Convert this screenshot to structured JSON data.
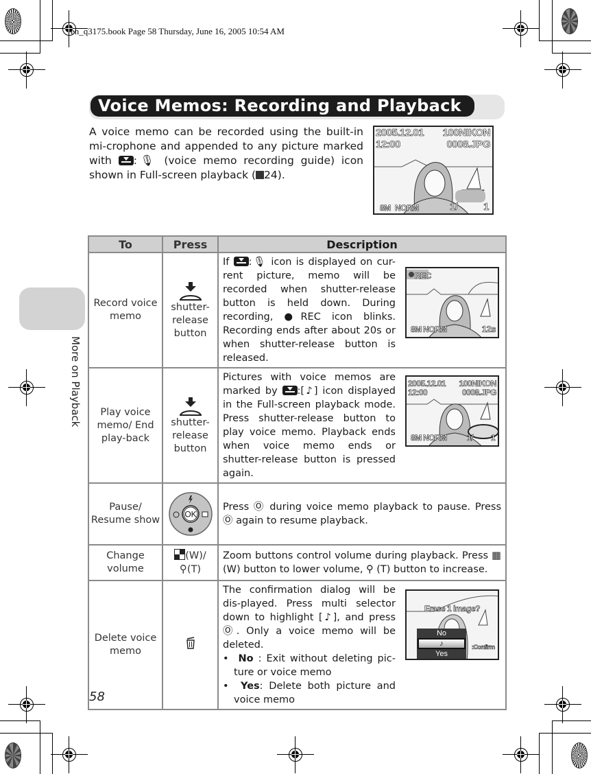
{
  "slug": "en_q3175.book  Page 58  Thursday, June 16, 2005  10:54 AM",
  "title": "Voice Memos: Recording and Playback",
  "intro": {
    "part1": "A voice memo can be recorded using the built-in mi-crophone and appended to any picture marked with",
    "part2": ":🎙 (voice memo recording guide) icon shown in Full-screen playback (",
    "ref": "24",
    "part3": ")."
  },
  "side_tab": "More on Playback",
  "page_number": "58",
  "screens": {
    "intro": {
      "date": "2005.12.01",
      "time": "12:00",
      "folder": "100NIKON",
      "file": "0008.JPG",
      "size": "8M",
      "quality": "NORM",
      "frame": "1/",
      "count": "1"
    },
    "record": {
      "rec": "REC",
      "size": "8M",
      "quality": "NORM",
      "timer": "12s"
    },
    "play": {
      "date": "2005.12.01",
      "time": "12:00",
      "folder": "100NIKON",
      "file": "0008.JPG",
      "size": "8M",
      "quality": "NORM",
      "frame": "1/",
      "count": "1"
    },
    "delete": {
      "prompt": "Erase 1 image?",
      "options": [
        "No",
        "♪",
        "Yes"
      ],
      "confirm": ":Confirm"
    }
  },
  "table": {
    "headers": [
      "To",
      "Press",
      "Description"
    ],
    "rows": [
      {
        "to": "Record voice memo",
        "press": "shutter-release button",
        "desc_a": "If",
        "desc_b": ":🎙 icon is displayed on cur-rent picture, memo will be recorded when shutter-release button is held down. During recording, ●REC icon blinks. Recording ends after about 20s or when shutter-release button is released."
      },
      {
        "to": "Play voice memo/ End play-back",
        "press": "shutter-release button",
        "desc_a": "Pictures with voice memos are marked by",
        "desc_b": ":[♪] icon displayed in the Full-screen playback mode. Press shutter-release button to play voice memo. Playback ends when voice memo ends or shutter-release button is pressed again."
      },
      {
        "to": "Pause/ Resume show",
        "press": "OK",
        "desc": "Press Ⓞ during voice memo playback to pause. Press Ⓞ again to resume playback."
      },
      {
        "to": "Change volume",
        "press_w": "(W)/",
        "press_t": "(T)",
        "desc": "Zoom buttons control volume during playback. Press ▦ (W) button to lower volume, ⚲ (T) button to increase."
      },
      {
        "to": "Delete voice memo",
        "press": "🗑",
        "desc": "The confirmation dialog will be dis-played. Press multi selector down to highlight [♪], and press Ⓞ. Only a voice memo will be deleted.",
        "bullets": [
          {
            "label": "No",
            "text": " : Exit without deleting pic-ture or voice memo"
          },
          {
            "label": "Yes",
            "text": ": Delete both picture and voice memo"
          }
        ]
      }
    ]
  }
}
